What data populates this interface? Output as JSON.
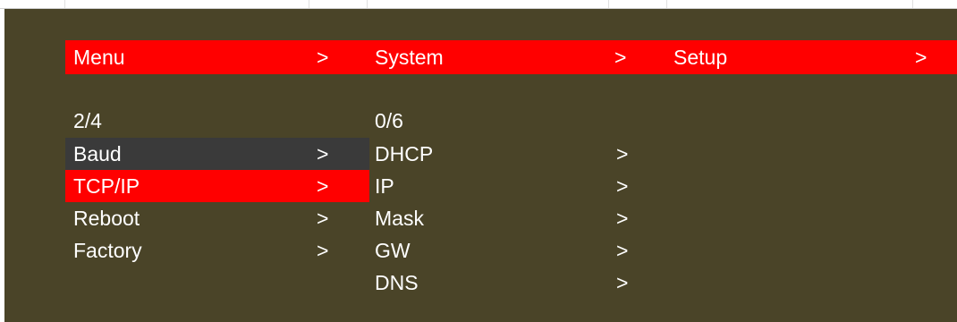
{
  "breadcrumb": {
    "items": [
      {
        "label": "Menu",
        "arrow": ">"
      },
      {
        "label": "System",
        "arrow": ">"
      },
      {
        "label": "Setup",
        "arrow": ">"
      }
    ]
  },
  "left_menu": {
    "position": "2/4",
    "items": [
      {
        "label": "Baud",
        "arrow": ">",
        "state": "highlighted-dark"
      },
      {
        "label": "TCP/IP",
        "arrow": ">",
        "state": "selected"
      },
      {
        "label": "Reboot",
        "arrow": ">",
        "state": "normal"
      },
      {
        "label": "Factory",
        "arrow": ">",
        "state": "normal"
      }
    ]
  },
  "right_menu": {
    "position": "0/6",
    "items": [
      {
        "label": "DHCP",
        "arrow": ">"
      },
      {
        "label": "IP",
        "arrow": ">"
      },
      {
        "label": "Mask",
        "arrow": ">"
      },
      {
        "label": "GW",
        "arrow": ">"
      },
      {
        "label": "DNS",
        "arrow": ">"
      }
    ]
  },
  "colors": {
    "background": "#4a4428",
    "accent": "#ff0000",
    "highlight": "#3a3a3a",
    "text": "#ffffff"
  }
}
